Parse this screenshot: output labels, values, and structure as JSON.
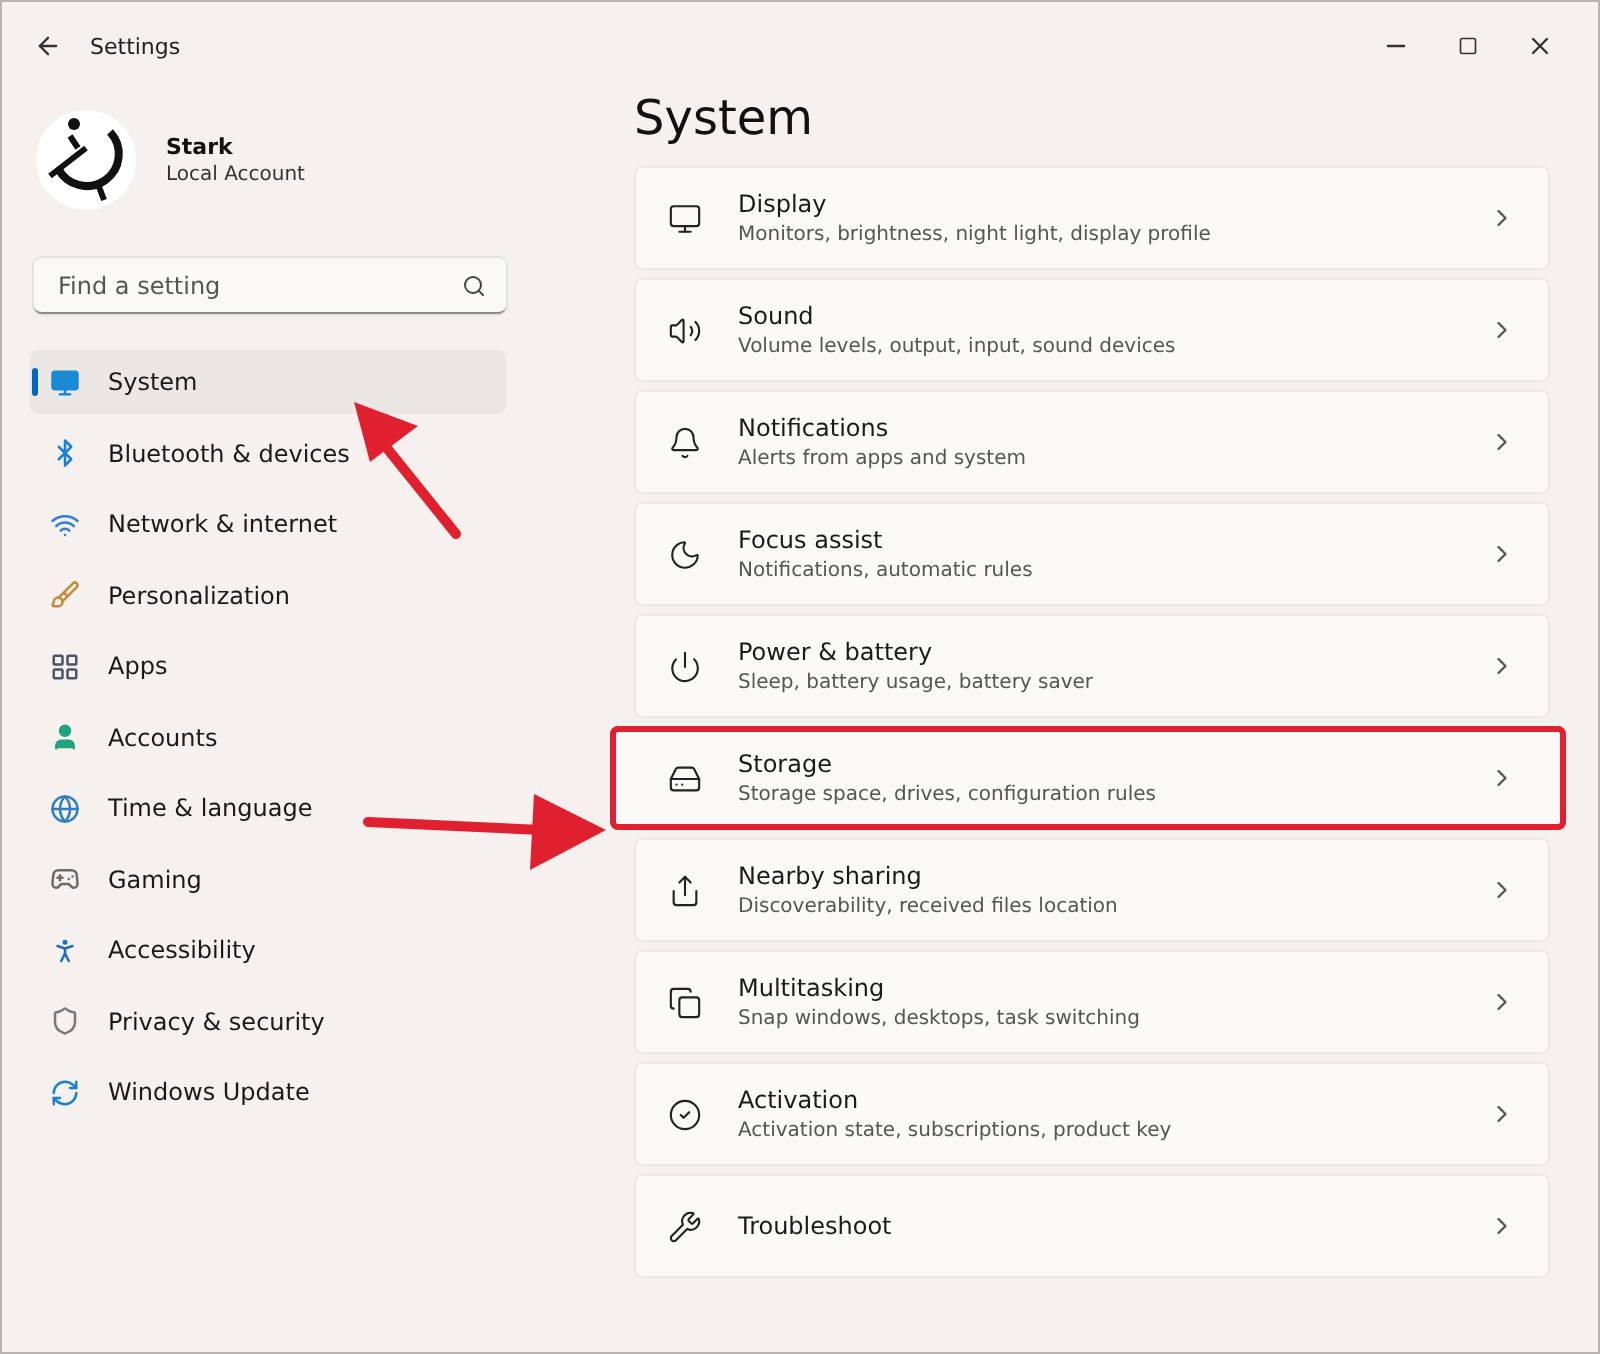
{
  "window": {
    "title": "Settings"
  },
  "account": {
    "name": "Stark",
    "type": "Local Account"
  },
  "search": {
    "placeholder": "Find a setting"
  },
  "sidebar": {
    "items": [
      {
        "label": "System",
        "selected": true
      },
      {
        "label": "Bluetooth & devices",
        "selected": false
      },
      {
        "label": "Network & internet",
        "selected": false
      },
      {
        "label": "Personalization",
        "selected": false
      },
      {
        "label": "Apps",
        "selected": false
      },
      {
        "label": "Accounts",
        "selected": false
      },
      {
        "label": "Time & language",
        "selected": false
      },
      {
        "label": "Gaming",
        "selected": false
      },
      {
        "label": "Accessibility",
        "selected": false
      },
      {
        "label": "Privacy & security",
        "selected": false
      },
      {
        "label": "Windows Update",
        "selected": false
      }
    ]
  },
  "page": {
    "title": "System",
    "items": [
      {
        "title": "Display",
        "subtitle": "Monitors, brightness, night light, display profile",
        "highlighted": false
      },
      {
        "title": "Sound",
        "subtitle": "Volume levels, output, input, sound devices",
        "highlighted": false
      },
      {
        "title": "Notifications",
        "subtitle": "Alerts from apps and system",
        "highlighted": false
      },
      {
        "title": "Focus assist",
        "subtitle": "Notifications, automatic rules",
        "highlighted": false
      },
      {
        "title": "Power & battery",
        "subtitle": "Sleep, battery usage, battery saver",
        "highlighted": false
      },
      {
        "title": "Storage",
        "subtitle": "Storage space, drives, configuration rules",
        "highlighted": true
      },
      {
        "title": "Nearby sharing",
        "subtitle": "Discoverability, received files location",
        "highlighted": false
      },
      {
        "title": "Multitasking",
        "subtitle": "Snap windows, desktops, task switching",
        "highlighted": false
      },
      {
        "title": "Activation",
        "subtitle": "Activation state, subscriptions, product key",
        "highlighted": false
      },
      {
        "title": "Troubleshoot",
        "highlighted": false
      }
    ]
  }
}
